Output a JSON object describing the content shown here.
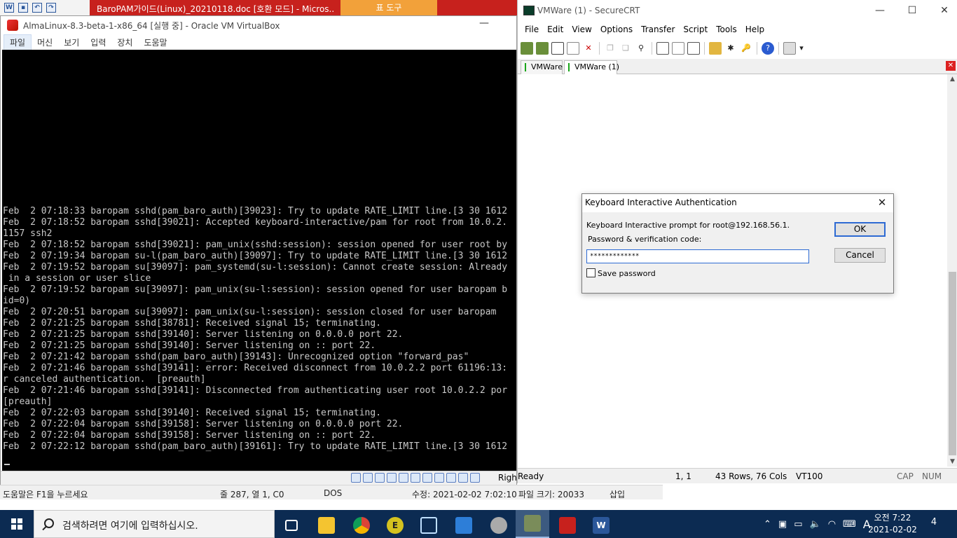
{
  "word": {
    "title": "BaroPAM가이드(Linux)_20210118.doc [호환 모드] - Micros...",
    "context_tab": "표 도구",
    "status": {
      "help": "도움말은 F1을 누르세요",
      "position": "줄 287, 열 1, C0",
      "mode": "DOS",
      "modified": "수정: 2021-02-02 7:02:10",
      "size": "파일 크기: 20033",
      "insert": "삽입"
    }
  },
  "vbox": {
    "title": "AlmaLinux-8.3-beta-1-x86_64 [실행 중] - Oracle VM VirtualBox",
    "menu": [
      "파일",
      "머신",
      "보기",
      "입력",
      "장치",
      "도움말"
    ],
    "hostkey": "Right Ctrl",
    "terminal_lines": [
      "Feb  2 07:18:33 baropam sshd(pam_baro_auth)[39023]: Try to update RATE_LIMIT line.[3 30 1612",
      "Feb  2 07:18:52 baropam sshd[39021]: Accepted keyboard-interactive/pam for root from 10.0.2.",
      "1157 ssh2",
      "Feb  2 07:18:52 baropam sshd[39021]: pam_unix(sshd:session): session opened for user root by",
      "Feb  2 07:19:34 baropam su-l(pam_baro_auth)[39097]: Try to update RATE_LIMIT line.[3 30 1612",
      "Feb  2 07:19:52 baropam su[39097]: pam_systemd(su-l:session): Cannot create session: Already",
      " in a session or user slice",
      "Feb  2 07:19:52 baropam su[39097]: pam_unix(su-l:session): session opened for user baropam b",
      "id=0)",
      "Feb  2 07:20:51 baropam su[39097]: pam_unix(su-l:session): session closed for user baropam",
      "Feb  2 07:21:25 baropam sshd[38781]: Received signal 15; terminating.",
      "Feb  2 07:21:25 baropam sshd[39140]: Server listening on 0.0.0.0 port 22.",
      "Feb  2 07:21:25 baropam sshd[39140]: Server listening on :: port 22.",
      "Feb  2 07:21:42 baropam sshd(pam_baro_auth)[39143]: Unrecognized option \"forward_pas\"",
      "Feb  2 07:21:46 baropam sshd[39141]: error: Received disconnect from 10.0.2.2 port 61196:13:",
      "r canceled authentication.  [preauth]",
      "Feb  2 07:21:46 baropam sshd[39141]: Disconnected from authenticating user root 10.0.2.2 por",
      "[preauth]",
      "Feb  2 07:22:03 baropam sshd[39140]: Received signal 15; terminating.",
      "Feb  2 07:22:04 baropam sshd[39158]: Server listening on 0.0.0.0 port 22.",
      "Feb  2 07:22:04 baropam sshd[39158]: Server listening on :: port 22.",
      "Feb  2 07:22:12 baropam sshd(pam_baro_auth)[39161]: Try to update RATE_LIMIT line.[3 30 1612"
    ]
  },
  "crt": {
    "title": "VMWare (1) - SecureCRT",
    "menu": [
      "File",
      "Edit",
      "View",
      "Options",
      "Transfer",
      "Script",
      "Tools",
      "Help"
    ],
    "tabs": [
      "VMWare",
      "VMWare (1)"
    ],
    "status": {
      "ready": "Ready",
      "cursor": "1,   1",
      "size": "43 Rows,  76 Cols",
      "emulation": "VT100",
      "cap": "CAP",
      "num": "NUM"
    }
  },
  "dialog": {
    "title": "Keyboard Interactive Authentication",
    "prompt": "Keyboard Interactive prompt for root@192.168.56.1.",
    "label": "Password & verification code:",
    "value": "*************",
    "save_password": "Save password",
    "ok": "OK",
    "cancel": "Cancel"
  },
  "taskbar": {
    "search_placeholder": "검색하려면 여기에 입력하십시오.",
    "ime": "A",
    "time": "오전 7:22",
    "date": "2021-02-02",
    "notifications": "4"
  },
  "colors": {
    "word_red": "#c7211d",
    "taskbar": "#0c2b52",
    "terminal_bg": "#000000",
    "terminal_fg": "#c8c8c8",
    "focus_blue": "#2d6ad3"
  }
}
